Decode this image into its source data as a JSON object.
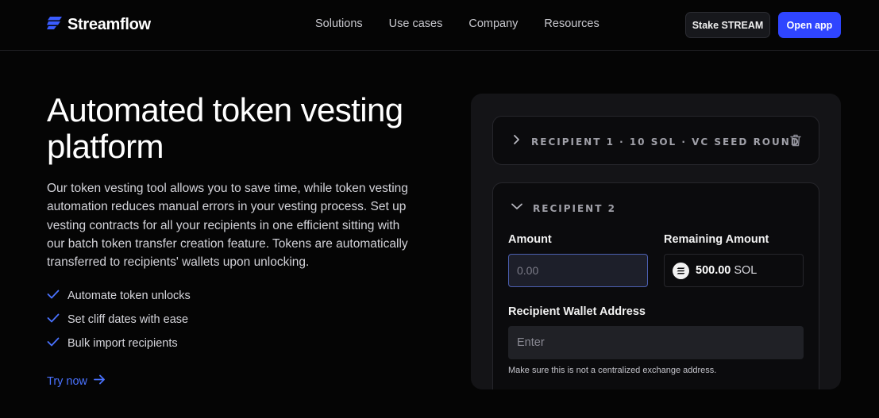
{
  "brand": {
    "name": "Streamflow"
  },
  "nav": {
    "links": [
      "Solutions",
      "Use cases",
      "Company",
      "Resources"
    ],
    "stake_label": "Stake STREAM",
    "open_label": "Open app"
  },
  "hero": {
    "title": "Automated token vesting platform",
    "description": "Our token vesting tool allows you to save time, while token vesting automation reduces manual errors in your vesting process. Set up vesting contracts for all your recipients in one efficient sitting with our batch token transfer creation feature. Tokens are automatically transferred to recipients' wallets upon unlocking.",
    "features": [
      "Automate token unlocks",
      "Set cliff dates with ease",
      "Bulk import recipients"
    ],
    "cta": "Try now"
  },
  "panel": {
    "recipient1": {
      "label": "RECIPIENT 1 · 10 SOL · VC SEED ROUND"
    },
    "recipient2": {
      "label": "RECIPIENT 2",
      "amount_label": "Amount",
      "amount_placeholder": "0.00",
      "remaining_label": "Remaining Amount",
      "remaining_value": "500.00",
      "remaining_unit": "SOL",
      "wallet_label": "Recipient Wallet Address",
      "wallet_placeholder": "Enter",
      "hint": "Make sure this is not a centralized exchange address."
    }
  },
  "colors": {
    "accent": "#2f45ff",
    "link": "#4a72ff",
    "background": "#050505"
  },
  "icons": [
    "streamflow-logo-icon",
    "check-icon",
    "arrow-right-icon",
    "chevron-right-icon",
    "chevron-down-icon",
    "trash-icon",
    "sol-coin-icon"
  ]
}
